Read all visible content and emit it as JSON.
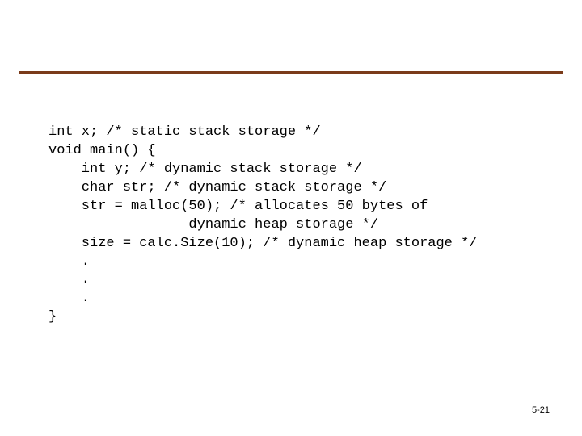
{
  "code": {
    "lines": [
      "int x; /* static stack storage */",
      "void main() {",
      "    int y; /* dynamic stack storage */",
      "    char str; /* dynamic stack storage */",
      "    str = malloc(50); /* allocates 50 bytes of",
      "                 dynamic heap storage */",
      "    size = calc.Size(10); /* dynamic heap storage */",
      "    .",
      "    .",
      "    .",
      "}"
    ]
  },
  "page_number": "5-21"
}
